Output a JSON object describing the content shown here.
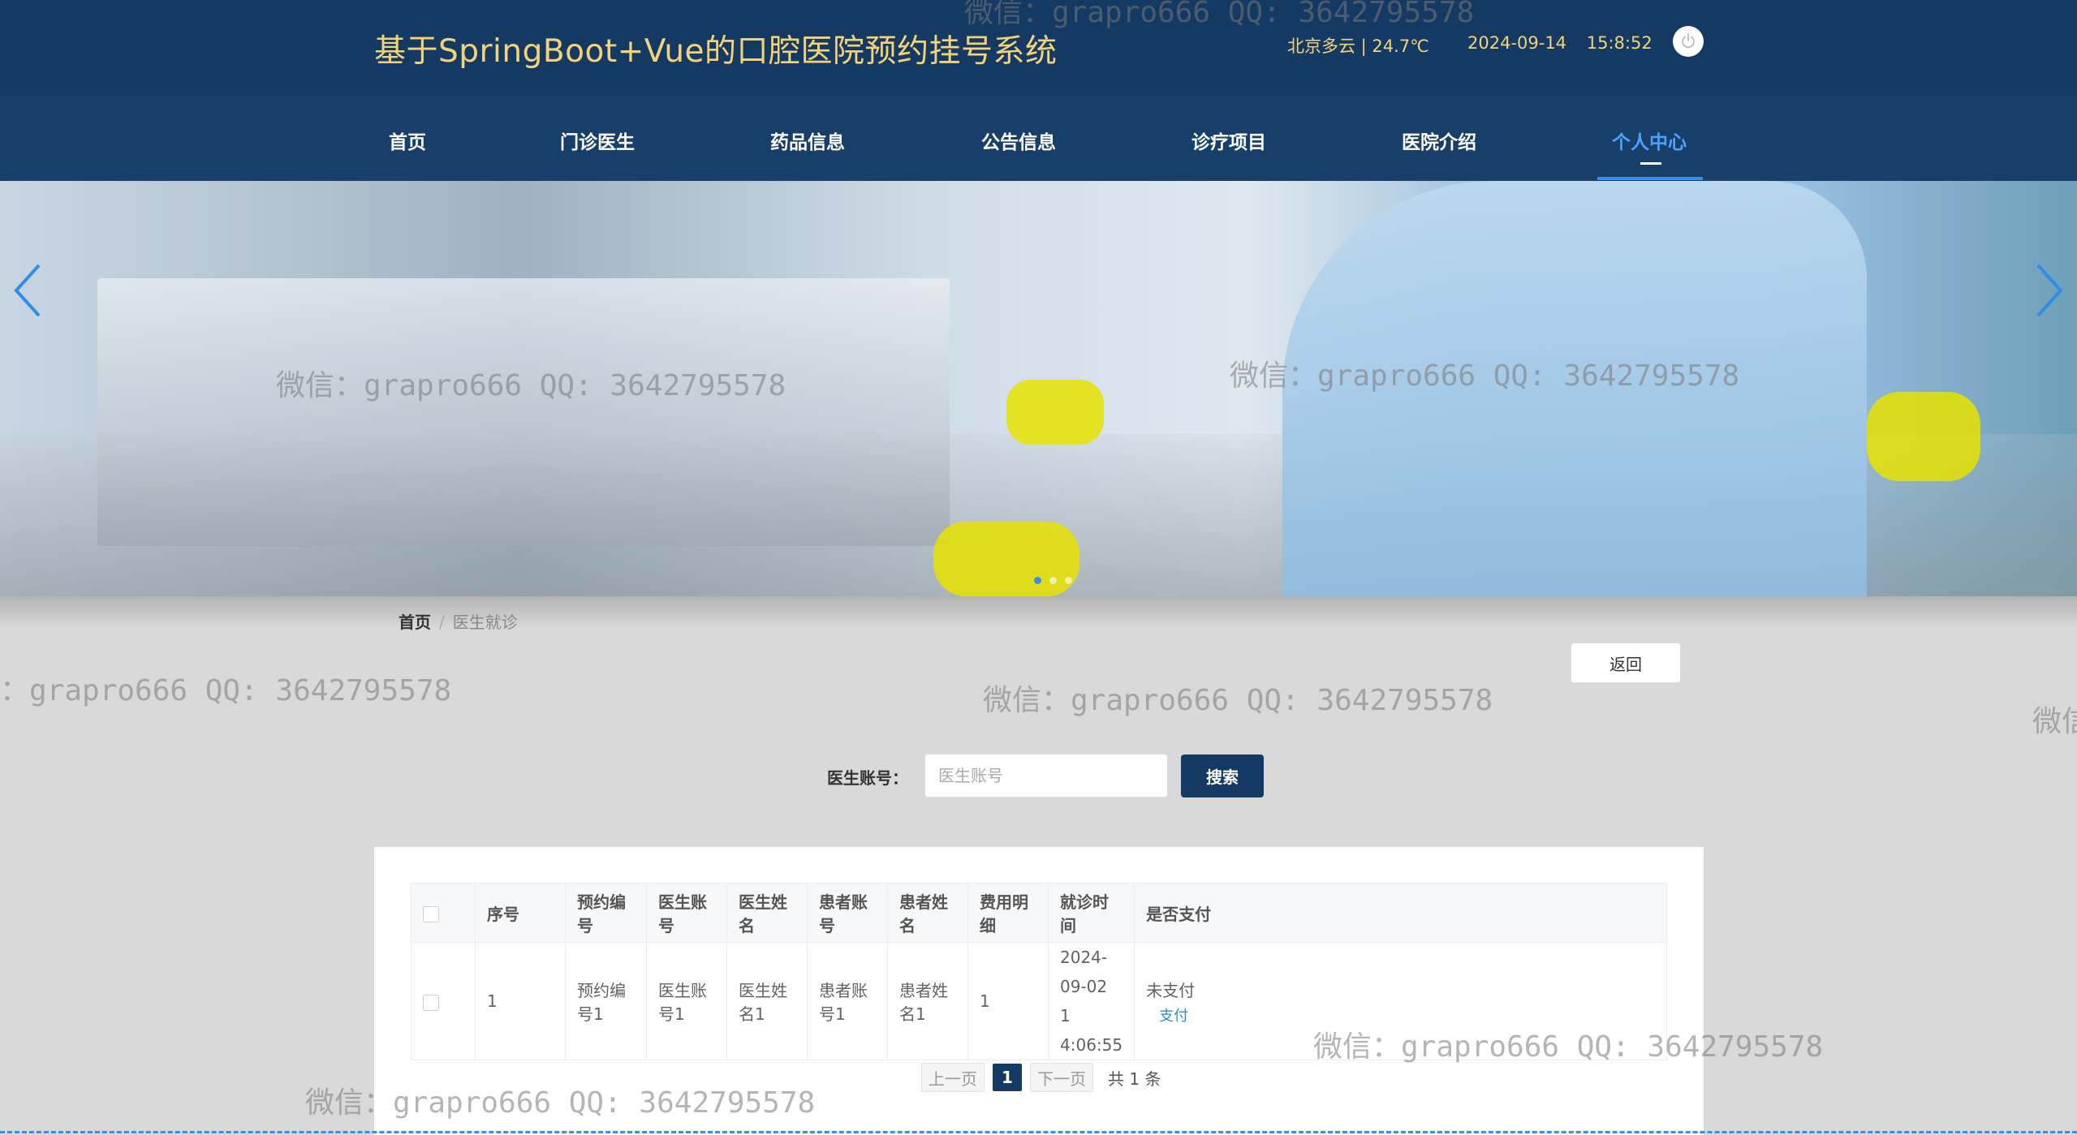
{
  "header": {
    "title": "基于SpringBoot+Vue的口腔医院预约挂号系统",
    "weather": "北京多云 | 24.7℃",
    "date": "2024-09-14",
    "time": "15:8:52",
    "power_icon": "power-icon"
  },
  "nav": {
    "items": [
      {
        "label": "首页"
      },
      {
        "label": "门诊医生"
      },
      {
        "label": "药品信息"
      },
      {
        "label": "公告信息"
      },
      {
        "label": "诊疗项目"
      },
      {
        "label": "医院介绍"
      },
      {
        "label": "个人中心"
      }
    ],
    "active_index": 6,
    "active_color": "#4aa3ff"
  },
  "carousel": {
    "prev_icon": "chevron-left-icon",
    "next_icon": "chevron-right-icon",
    "slide_count": 3,
    "active_slide": 0
  },
  "breadcrumb": {
    "home": "首页",
    "separator": "/",
    "current": "医生就诊"
  },
  "back_button": "返回",
  "search": {
    "label": "医生账号：",
    "placeholder": "医生账号",
    "value": "",
    "button": "搜索"
  },
  "table": {
    "headers": [
      "序号",
      "预约编号",
      "医生账号",
      "医生姓名",
      "患者账号",
      "患者姓名",
      "费用明细",
      "就诊时间",
      "是否支付"
    ],
    "rows": [
      {
        "index": "1",
        "booking_no": "预约编号1",
        "doctor_account": "医生账号1",
        "doctor_name": "医生姓名1",
        "patient_account": "患者账号1",
        "patient_name": "患者姓名1",
        "fee": "1",
        "visit_time_line1": "2024-09-02 1",
        "visit_time_line2": "4:06:55",
        "paid_status": "未支付",
        "pay_action": "支付"
      }
    ]
  },
  "pagination": {
    "prev": "上一页",
    "current": "1",
    "next": "下一页",
    "total": "共 1 条"
  },
  "watermark": "微信：grapro666 QQ: 3642795578",
  "colors": {
    "header_bg": "#143a63",
    "title_color": "#f4d27a",
    "primary": "#143a63",
    "link": "#2e8ee6"
  }
}
